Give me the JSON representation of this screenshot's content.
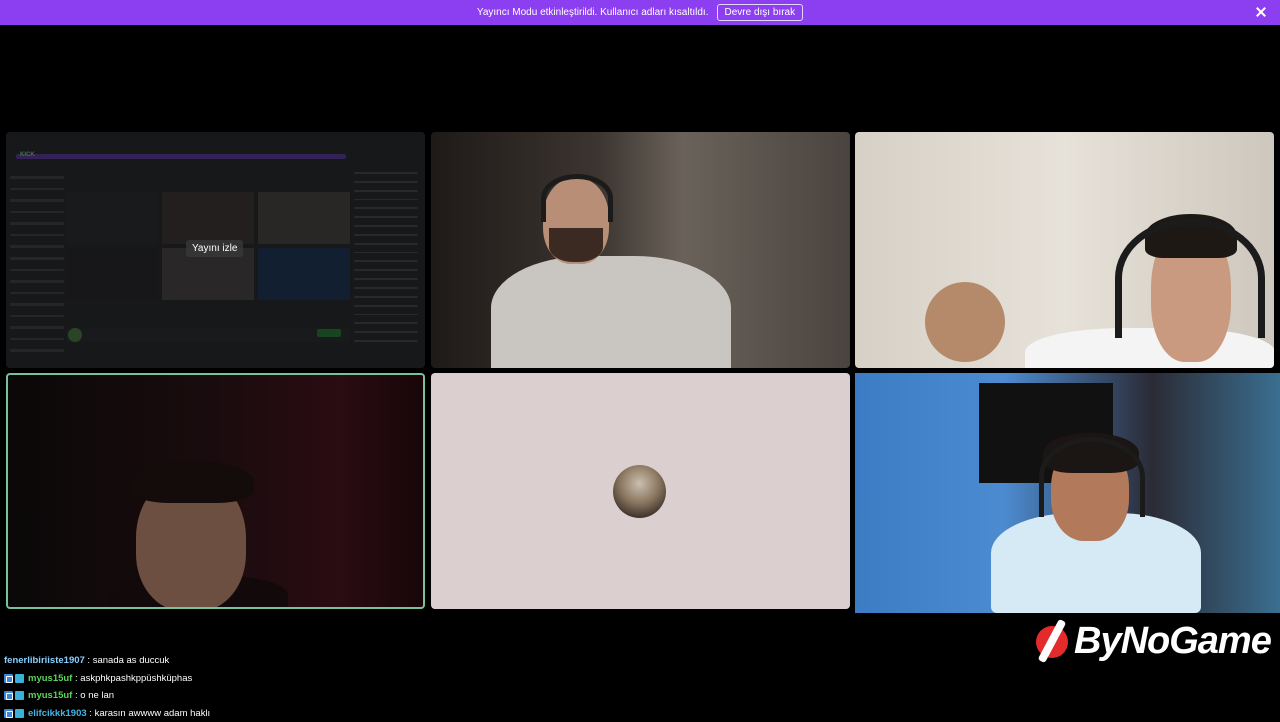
{
  "banner": {
    "message": "Yayıncı Modu etkinleştirildi. Kullanıcı adları kısaltıldı.",
    "button_label": "Devre dışı bırak"
  },
  "tiles": {
    "screen_share": {
      "watch_label": "Yayını izle",
      "app_logo": "KICK"
    }
  },
  "logo": {
    "text": "ByNoGame"
  },
  "chat": [
    {
      "user": "fenerlibiriiste1907",
      "message": "sanada as duccuk",
      "badges": 0,
      "color": "#8ad0ff"
    },
    {
      "user": "myus15uf",
      "message": "askphkpashkppüshküphas",
      "badges": 2,
      "color": "#5bd45b"
    },
    {
      "user": "myus15uf",
      "message": "o ne lan",
      "badges": 2,
      "color": "#5bd45b"
    },
    {
      "user": "elifcikkk1903",
      "message": "karasın awwww adam haklı",
      "badges": 2,
      "color": "#43b6e4"
    }
  ],
  "colors": {
    "banner": "#8c3ff0",
    "active_speaker_border": "#76c29a",
    "logo_red": "#e32b2b"
  }
}
